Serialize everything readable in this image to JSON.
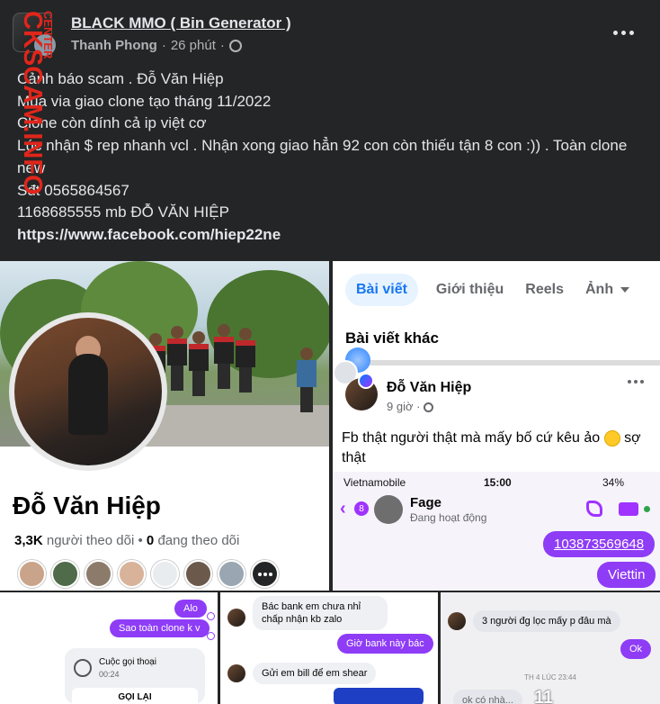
{
  "post": {
    "group_name": "BLACK MMO ( Bin Generator )",
    "author": "Thanh Phong",
    "separator": "·",
    "time": "26 phút",
    "separator2": "·",
    "lines": [
      "Cảnh báo scam . Đỗ Văn Hiệp",
      "Mua via giao clone tạo tháng 11/2022",
      "Clone còn dính cả ip việt cơ",
      "Lúc nhận $ rep nhanh vcl . Nhận xong giao hẳn 92 con còn thiếu tận 8 con :)) . Toàn clone new",
      "Sđt 0565864567",
      "1168685555 mb ĐỖ VĂN HIỆP"
    ],
    "link": "https://www.facebook.com/hiep22ne"
  },
  "watermark": {
    "text": "CKSCAM.INFO",
    "small": "CENTER",
    "color": "#e0261b"
  },
  "profile": {
    "name": "Đỗ Văn Hiệp",
    "followers_count": "3,3K",
    "followers_label": "người theo dõi",
    "dot": "•",
    "following_count": "0",
    "following_label": "đang theo dõi"
  },
  "profile_page": {
    "tabs": [
      "Bài viết",
      "Giới thiệu",
      "Reels",
      "Ảnh"
    ],
    "other_posts": "Bài viết khác",
    "poster_name": "Đỗ Văn Hiệp",
    "poster_time": "9 giờ",
    "poster_sep": "·",
    "post_text": "Fb thật người thật mà mấy bố cứ kêu ảo",
    "post_text_end": "sợ thật"
  },
  "messenger": {
    "carrier": "Vietnamobile",
    "time": "15:00",
    "battery": "34%",
    "badge": "8",
    "name": "Fage",
    "status": "Đang hoạt động",
    "msg_account": "103873569648",
    "msg_bank": "Viettin"
  },
  "chat1": {
    "msg1": "Alo",
    "msg2": "Sao toàn clone k v",
    "call_title": "Cuộc gọi thoại",
    "call_dur": "00:24",
    "call_back": "GỌI LẠI"
  },
  "chat2": {
    "msg1": "Bác bank em chưa nhỉ chấp nhận kb zalo",
    "msg2": "Giờ bank này bác",
    "msg3": "Gửi em bill để em shear"
  },
  "chat3": {
    "msg1": "3 người đg lọc mấy p đâu mà",
    "msg2": "Ok",
    "timestamp": "TH 4 LÚC 23:44",
    "partial": "ok có nhà...",
    "big": "11"
  }
}
